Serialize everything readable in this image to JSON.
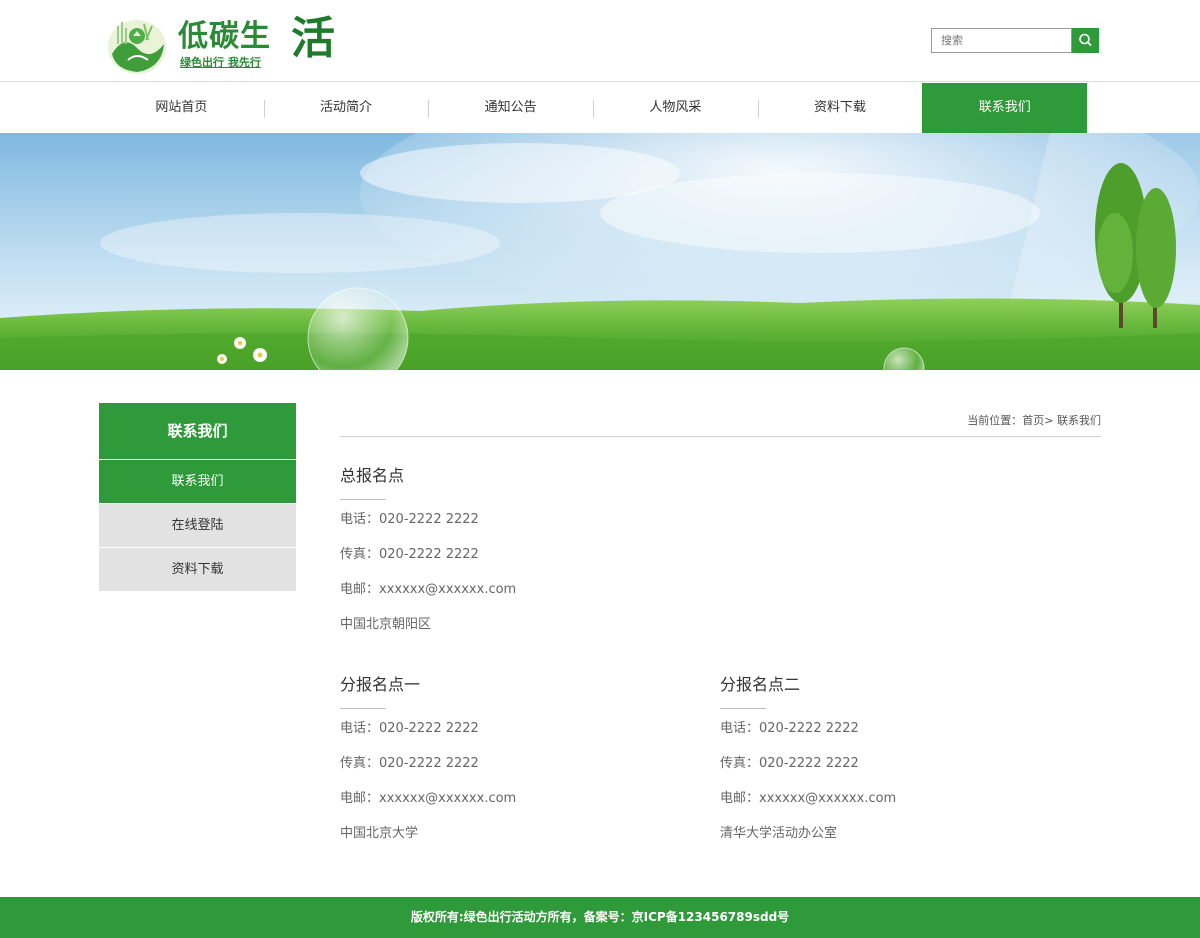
{
  "header": {
    "logo_title": "低碳生",
    "logo_title_big": "活",
    "logo_subtitle": "绿色出行 我先行",
    "search_placeholder": "搜索"
  },
  "nav": {
    "items": [
      {
        "label": "网站首页"
      },
      {
        "label": "活动简介"
      },
      {
        "label": "通知公告"
      },
      {
        "label": "人物风采"
      },
      {
        "label": "资料下载"
      },
      {
        "label": "联系我们",
        "active": true
      }
    ]
  },
  "sidebar": {
    "title": "联系我们",
    "items": [
      {
        "label": "联系我们",
        "active": true
      },
      {
        "label": "在线登陆"
      },
      {
        "label": "资料下载"
      }
    ]
  },
  "breadcrumb": {
    "prefix": "当前位置：",
    "home": "首页",
    "separator": ">",
    "current": "联系我们"
  },
  "contacts": [
    {
      "title": "总报名点",
      "phone": "电话：020-2222 2222",
      "fax": "传真：020-2222 2222",
      "email": "电邮：xxxxxx@xxxxxx.com",
      "address": "中国北京朝阳区"
    },
    {
      "title": "分报名点一",
      "phone": "电话：020-2222 2222",
      "fax": "传真：020-2222 2222",
      "email": "电邮：xxxxxx@xxxxxx.com",
      "address": "中国北京大学"
    },
    {
      "title": "分报名点二",
      "phone": "电话：020-2222 2222",
      "fax": "传真：020-2222 2222",
      "email": "电邮：xxxxxx@xxxxxx.com",
      "address": "清华大学活动办公室"
    }
  ],
  "footer": {
    "text": "版权所有:绿色出行活动方所有，备案号：京ICP备123456789sdd号"
  },
  "colors": {
    "brand_green": "#2e9a39",
    "sidebar_inactive": "#e2e2e2"
  }
}
